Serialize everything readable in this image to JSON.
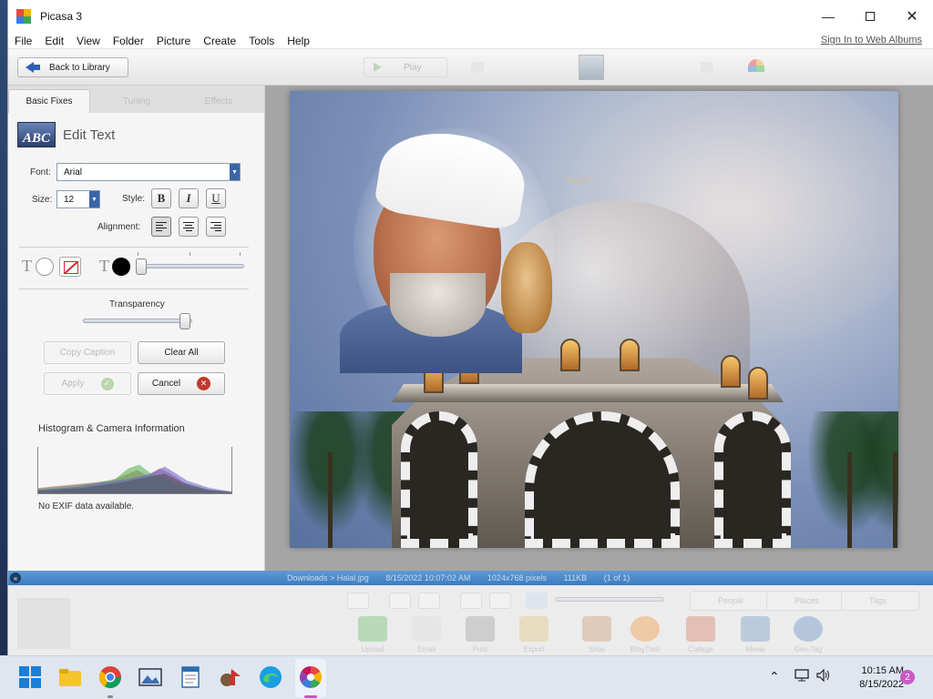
{
  "window": {
    "title": "Picasa 3"
  },
  "menu": {
    "items": [
      "File",
      "Edit",
      "View",
      "Folder",
      "Picture",
      "Create",
      "Tools",
      "Help"
    ],
    "sign_in": "Sign In to Web Albums"
  },
  "toolbar": {
    "back_label": "Back to Library",
    "play_label": "Play"
  },
  "tabs": [
    "Basic Fixes",
    "Tuning",
    "Effects"
  ],
  "edit_text": {
    "icon_text": "ABC",
    "title": "Edit Text",
    "font_label": "Font:",
    "font_value": "Arial",
    "size_label": "Size:",
    "size_value": "12",
    "style_label": "Style:",
    "bold": "B",
    "italic": "I",
    "underline": "U",
    "alignment_label": "Alignment:",
    "text_glyph": "T",
    "transparency_label": "Transparency",
    "copy_caption": "Copy Caption",
    "clear_all": "Clear All",
    "apply": "Apply",
    "cancel": "Cancel"
  },
  "histogram": {
    "title": "Histogram & Camera Information",
    "exif": "No EXIF data available."
  },
  "status": {
    "path": "Downloads > Halal.jpg",
    "datetime": "8/15/2022 10:07:02 AM",
    "dimensions": "1024x768 pixels",
    "size": "111KB",
    "position": "(1 of 1)"
  },
  "tray": {
    "pills": [
      "People",
      "Places",
      "Tags"
    ],
    "actions": [
      "Upload",
      "Email",
      "Print",
      "Export",
      "Shop",
      "BlogThis!",
      "Collage",
      "Movie",
      "Geo-Tag"
    ]
  },
  "taskbar": {
    "time": "10:15 AM",
    "date": "8/15/2022",
    "notifications": "2"
  }
}
